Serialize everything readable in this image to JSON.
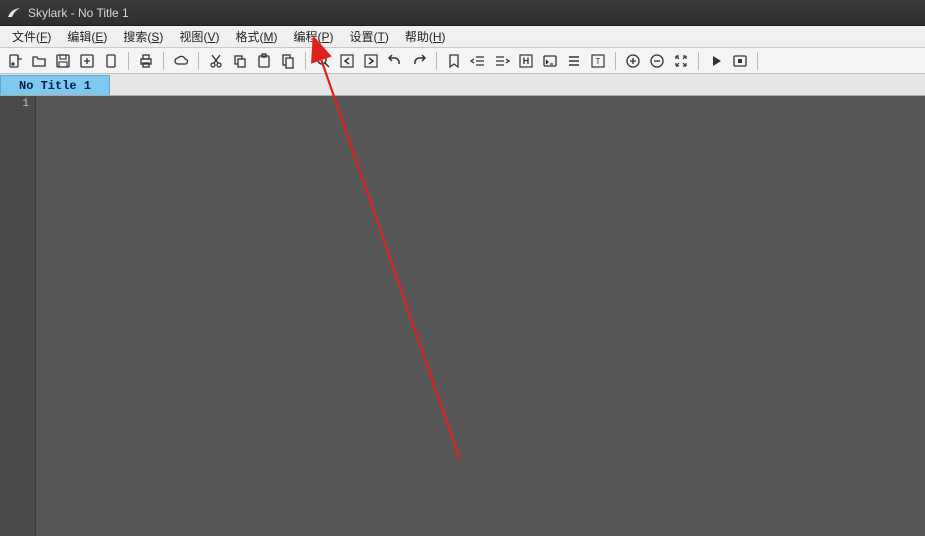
{
  "window": {
    "title": "Skylark - No Title 1"
  },
  "menu": {
    "items": [
      {
        "label": "文件",
        "accel": "F"
      },
      {
        "label": "编辑",
        "accel": "E"
      },
      {
        "label": "搜索",
        "accel": "S"
      },
      {
        "label": "视图",
        "accel": "V"
      },
      {
        "label": "格式",
        "accel": "M"
      },
      {
        "label": "编程",
        "accel": "P"
      },
      {
        "label": "设置",
        "accel": "T"
      },
      {
        "label": "帮助",
        "accel": "H"
      }
    ]
  },
  "toolbar": {
    "groups": [
      [
        "new-file-icon",
        "open-folder-icon",
        "save-icon",
        "save-as-icon",
        "doc-icon"
      ],
      [
        "print-icon"
      ],
      [
        "cloud-icon"
      ],
      [
        "cut-icon",
        "copy-icon",
        "paste-icon",
        "docs-icon"
      ],
      [
        "search-icon",
        "prev-icon",
        "next-icon",
        "undo-icon",
        "redo-icon"
      ],
      [
        "bookmark-icon",
        "outdent-icon",
        "indent-icon",
        "header-icon",
        "console-icon",
        "list-icon",
        "insert-icon"
      ],
      [
        "zoom-in-icon",
        "zoom-out-icon",
        "expand-icon"
      ],
      [
        "play-icon",
        "stop-icon"
      ]
    ]
  },
  "tabs": {
    "items": [
      {
        "label": "No Title 1"
      }
    ]
  },
  "editor": {
    "lines": [
      "1"
    ]
  }
}
